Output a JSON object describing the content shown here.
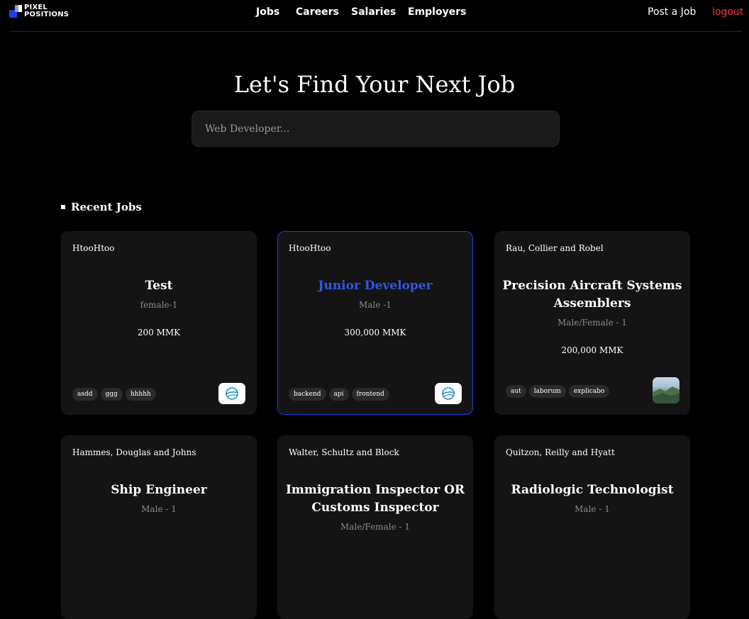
{
  "brand": {
    "line1": "PIXEL",
    "line2": "POSITIONS"
  },
  "nav": {
    "links": [
      "Jobs",
      "Careers",
      "Salaries",
      "Employers"
    ],
    "post_job": "Post a Job",
    "logout": "logout"
  },
  "hero": {
    "title": "Let's Find Your Next Job",
    "search_placeholder": "Web Developer..."
  },
  "recent": {
    "heading": "Recent Jobs"
  },
  "jobs": [
    {
      "company": "HtooHtoo",
      "title": "Test",
      "meta": "female-1",
      "salary": "200 MMK",
      "tags": [
        "asdd",
        "ggg",
        "hhhhh"
      ],
      "logo": "globe-emblem-icon"
    },
    {
      "company": "HtooHtoo",
      "title": "Junior Developer",
      "meta": "Male -1",
      "salary": "300,000 MMK",
      "tags": [
        "backend",
        "api",
        "frontend"
      ],
      "logo": "globe-emblem-icon"
    },
    {
      "company": "Rau, Collier and Robel",
      "title": "Precision Aircraft Systems Assemblers",
      "meta": "Male/Female - 1",
      "salary": "200,000 MMK",
      "tags": [
        "aut",
        "laborum",
        "explicabo"
      ],
      "logo": "landscape-photo-icon"
    },
    {
      "company": "Hammes, Douglas and Johns",
      "title": "Ship Engineer",
      "meta": "Male - 1"
    },
    {
      "company": "Walter, Schultz and Block",
      "title": "Immigration Inspector OR Customs Inspector",
      "meta": "Male/Female - 1"
    },
    {
      "company": "Quitzon, Reilly and Hyatt",
      "title": "Radiologic Technologist",
      "meta": "Male - 1"
    }
  ],
  "colors": {
    "accent": "#1f3fe6",
    "logout": "#ef3b3b",
    "card": "#141414"
  }
}
